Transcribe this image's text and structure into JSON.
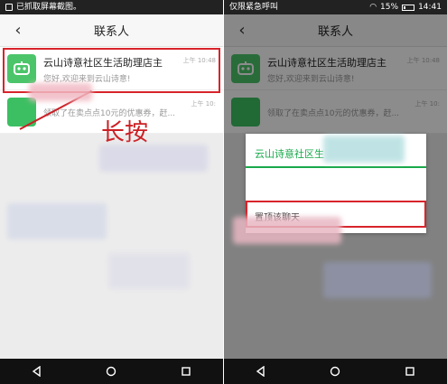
{
  "left": {
    "status_text": "已抓取屏幕截图。",
    "title": "联系人",
    "contact": {
      "name": "云山诗意社区生活助理店主",
      "preview": "您好,欢迎来到云山诗意!",
      "time": "上午 10:48"
    },
    "second_row": {
      "preview": "领取了在卖点点10元的优惠券，赶...",
      "time": "上午 10:"
    },
    "annotation": "长按"
  },
  "right": {
    "status_text": "仅限紧急呼叫",
    "battery": "15%",
    "clock": "14:41",
    "title": "联系人",
    "contact": {
      "name": "云山诗意社区生活助理店主",
      "preview": "您好,欢迎来到云山诗意!",
      "time": "上午 10:48"
    },
    "second_row": {
      "preview": "领取了在卖点点10元的优惠券，赶...",
      "time": "上午 10:"
    },
    "dialog": {
      "title": "云山诗意社区生",
      "item": "置顶该聊天"
    }
  },
  "colors": {
    "brand_green": "#4cc56a",
    "dialog_green": "#19a94b",
    "highlight_red": "#d8242b"
  },
  "icons": {
    "back": "back-arrow-icon",
    "avatar": "robot-face-icon",
    "nav_back": "triangle-back-icon",
    "nav_home": "circle-home-icon",
    "nav_recent": "square-recent-icon"
  }
}
